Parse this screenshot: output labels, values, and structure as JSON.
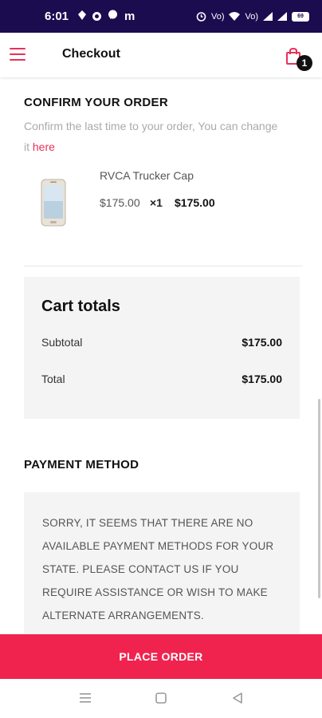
{
  "status_bar": {
    "time": "6:01",
    "indicators": [
      "signal-icon",
      "circle-icon",
      "messenger-icon",
      "m-icon"
    ],
    "m_label": "m",
    "network_label_1": "Vo)",
    "network_label_2": "Vo)",
    "battery_level": "69"
  },
  "header": {
    "menu_icon": "hamburger-icon",
    "title": "Checkout",
    "cart_icon": "shopping-bag-icon",
    "cart_count": "1",
    "accent_color": "#e8315b"
  },
  "confirm": {
    "title": "CONFIRM YOUR ORDER",
    "description": "Confirm the last time to your order, You can change it ",
    "link_text": "here"
  },
  "order_items": [
    {
      "image_icon": "smartphone-product-image",
      "name": "RVCA Trucker Cap",
      "price": "$175.00",
      "quantity": "×1",
      "line_total": "$175.00"
    }
  ],
  "cart_totals": {
    "title": "Cart totals",
    "subtotal_label": "Subtotal",
    "subtotal_value": "$175.00",
    "total_label": "Total",
    "total_value": "$175.00"
  },
  "payment": {
    "title": "PAYMENT METHOD",
    "message": "SORRY, IT SEEMS THAT THERE ARE NO AVAILABLE PAYMENT METHODS FOR YOUR STATE. PLEASE CONTACT US IF YOU REQUIRE ASSISTANCE OR WISH TO MAKE ALTERNATE ARRANGEMENTS."
  },
  "place_order": {
    "label": "PLACE ORDER",
    "color": "#f0234f"
  },
  "nav_bar": {
    "buttons": [
      "recent-apps-icon",
      "home-icon",
      "back-icon"
    ]
  }
}
